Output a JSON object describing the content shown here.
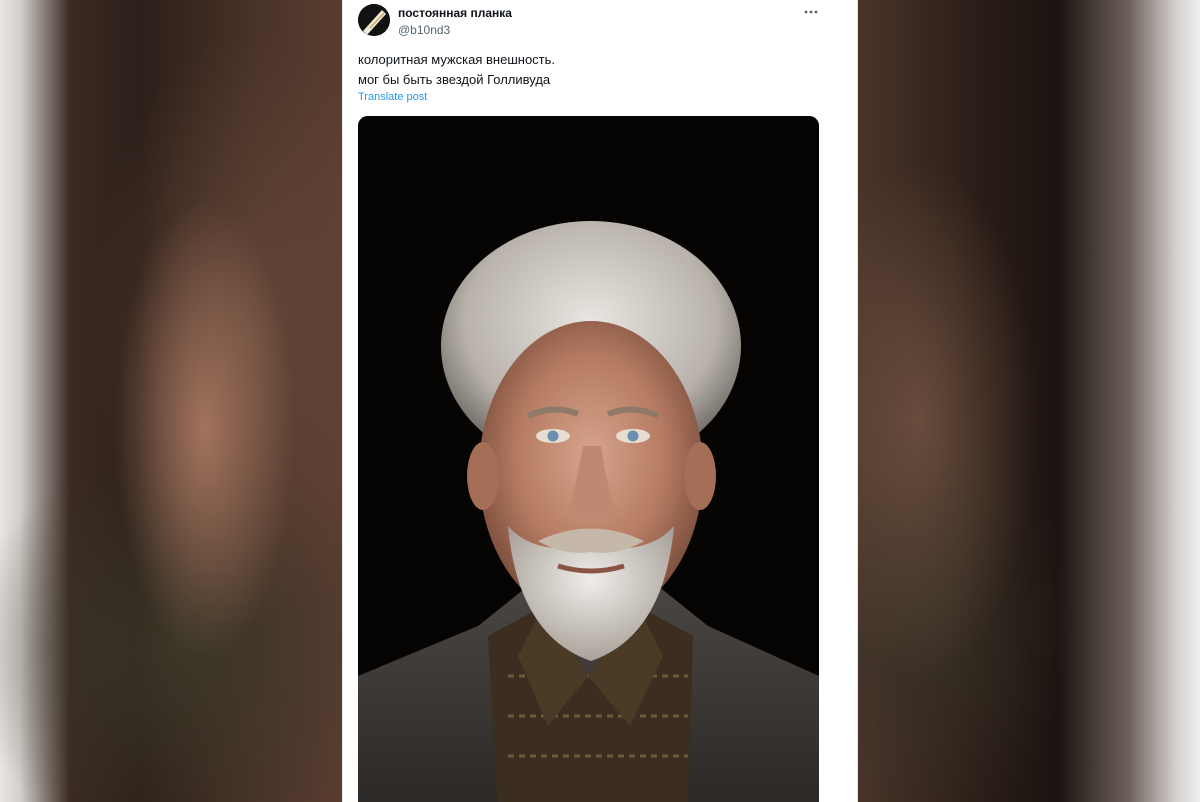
{
  "post": {
    "author": {
      "display_name": "постоянная планка",
      "handle": "@b10nd3",
      "avatar_icon": "avatar-icon"
    },
    "more_icon": "more-icon",
    "text_lines": [
      "колоритная мужская внешность.",
      "мог бы быть звездой Голливуда"
    ],
    "translate_label": "Translate post",
    "media": {
      "description_icon": "photo-portrait"
    }
  },
  "colors": {
    "link": "#1d9bf0",
    "text_primary": "#0f1419",
    "text_secondary": "#536471",
    "card_bg": "#ffffff"
  }
}
